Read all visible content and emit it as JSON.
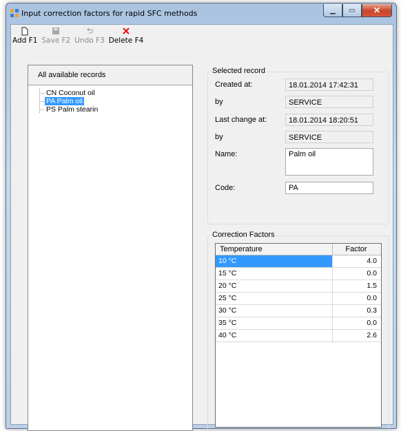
{
  "window": {
    "title": "Input correction factors for rapid SFC methods"
  },
  "toolbar": {
    "add": "Add F1",
    "save": "Save F2",
    "undo": "Undo F3",
    "delete": "Delete F4"
  },
  "records_panel": {
    "header": "All available records",
    "items": [
      {
        "label": "CN Coconut oil",
        "selected": false
      },
      {
        "label": "PA Palm oil",
        "selected": true
      },
      {
        "label": "PS Palm stearin",
        "selected": false
      }
    ]
  },
  "selected_record": {
    "group_title": "Selected record",
    "created_at_label": "Created at:",
    "created_at": "18.01.2014 17:42:31",
    "created_by_label": "by",
    "created_by": "SERVICE",
    "last_change_label": "Last change at:",
    "last_change": "18.01.2014 18:20:51",
    "changed_by_label": "by",
    "changed_by": "SERVICE",
    "name_label": "Name:",
    "name": "Palm oil",
    "code_label": "Code:",
    "code": "PA"
  },
  "correction_factors": {
    "group_title": "Correction Factors",
    "col_temperature": "Temperature",
    "col_factor": "Factor",
    "rows": [
      {
        "temperature": "10 °C",
        "factor": "4.0"
      },
      {
        "temperature": "15 °C",
        "factor": "0.0"
      },
      {
        "temperature": "20 °C",
        "factor": "1.5"
      },
      {
        "temperature": "25 °C",
        "factor": "0.0"
      },
      {
        "temperature": "30 °C",
        "factor": "0.3"
      },
      {
        "temperature": "35 °C",
        "factor": "0.0"
      },
      {
        "temperature": "40 °C",
        "factor": "2.6"
      }
    ]
  },
  "colors": {
    "selection": "#3399ff",
    "delete_icon": "#e81010"
  }
}
